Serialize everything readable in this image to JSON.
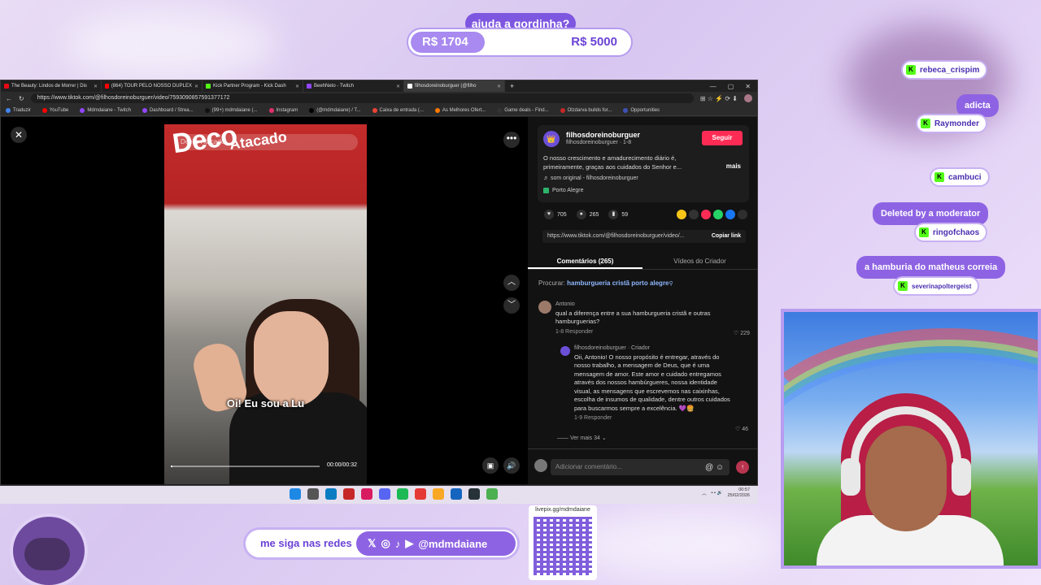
{
  "goal": {
    "title": "ajuda a gordinha?",
    "current": "R$ 1704",
    "target": "R$ 5000",
    "progress_fraction": 0.34
  },
  "browser": {
    "tabs": [
      {
        "label": "The Beauty: Lindos de Morrer | Dis",
        "color": "#e50914"
      },
      {
        "label": "(864) TOUR PELO NOSSO DUPLEX",
        "color": "#ff0000"
      },
      {
        "label": "Kick Partner Program - Kick Dash",
        "color": "#53fc18"
      },
      {
        "label": "BeehNeto - Twitch",
        "color": "#9146ff"
      },
      {
        "label": "filhosdoreinoburguer (@filho",
        "color": "#ffffff"
      }
    ],
    "url": "https://www.tiktok.com/@filhosdoreinoburguer/video/7593090857591377172",
    "bookmarks": [
      {
        "label": "Traduzir",
        "color": "#4285f4"
      },
      {
        "label": "YouTube",
        "color": "#ff0000"
      },
      {
        "label": "Mdmdaiane - Twitch",
        "color": "#9146ff"
      },
      {
        "label": "Dashboard / Strea...",
        "color": "#9146ff"
      },
      {
        "label": "(99+) mdmdaiane (...",
        "color": "#111111"
      },
      {
        "label": "Instagram",
        "color": "#e1306c"
      },
      {
        "label": "(@mdmdaiane) / T...",
        "color": "#000000"
      },
      {
        "label": "Caixa de entrada (...",
        "color": "#ea4335"
      },
      {
        "label": "As Melhores Ofert...",
        "color": "#ff7a00"
      },
      {
        "label": "Game deals - Find...",
        "color": "#333333"
      },
      {
        "label": "Olzdarva builds for...",
        "color": "#c62828"
      },
      {
        "label": "Opportunities",
        "color": "#3f51b5"
      }
    ]
  },
  "video": {
    "search_placeholder": "Deeco Atacado",
    "sign_text": "Deco",
    "sign_sub": "Atacado",
    "caption": "Oi! Eu sou a Lu",
    "time": "00:00/00:32",
    "progress_fraction": 0.0
  },
  "post": {
    "username": "filhosdoreinoburguer",
    "subline": "filhosdoreinoburguer · 1-8",
    "follow": "Seguir",
    "description": "O nosso crescimento e amadurecimento diário é, primeiramente, graças aos cuidados do Senhor e...",
    "more": "mais",
    "music": "♬ som original - filhosdoreinoburguer",
    "location": "Porto Alegre",
    "likes": "705",
    "comments": "265",
    "saves": "59",
    "link": "https://www.tiktok.com/@filhosdoreinoburguer/video/...",
    "copy": "Copiar link",
    "tab_comments": "Comentários (265)",
    "tab_videos": "Vídeos do Criador",
    "search_label": "Procurar:",
    "search_query": "hamburgueria cristã porto alegre"
  },
  "comments": {
    "c1": {
      "name": "Antonio",
      "text": "qual a diferença entre a sua hamburgueria cristã e outras hamburguerias?",
      "meta": "1-8   Responder",
      "likes": "♡ 229"
    },
    "c2": {
      "name": "filhosdoreinoburguer · Criador",
      "text": "Oii, Antonio! O nosso propósito é entregar, através do nosso trabalho, a mensagem de Deus, que é uma mensagem de amor. Este amor e cuidado entregamos através dos nossos hambúrgueres, nossa identidade visual, as mensagens que escrevemos nas caixinhas, escolha de insumos de qualidade, dentre outros cuidados para buscarmos sempre a excelência. 💜🍔",
      "meta": "1-9   Responder",
      "likes": "♡ 46"
    },
    "more_replies": "—— Ver mais 34 ⌄",
    "add_placeholder": "Adicionar comentário..."
  },
  "taskbar": {
    "time": "00:57",
    "date": "25/02/2026"
  },
  "chat": [
    {
      "user": "rebeca_crispim",
      "message": ""
    },
    {
      "user": "Raymonder",
      "message": "adicta"
    },
    {
      "user": "cambuci",
      "message": ""
    },
    {
      "user": "ringofchaos",
      "message": "Deleted by a moderator"
    },
    {
      "user": "severinapoltergeist",
      "message": "a hamburia do matheus correia"
    }
  ],
  "social": {
    "label": "me siga nas redes",
    "handle": "@mdmdaiane"
  },
  "qr": {
    "label": "livepix.gg/mdmdaiane"
  }
}
